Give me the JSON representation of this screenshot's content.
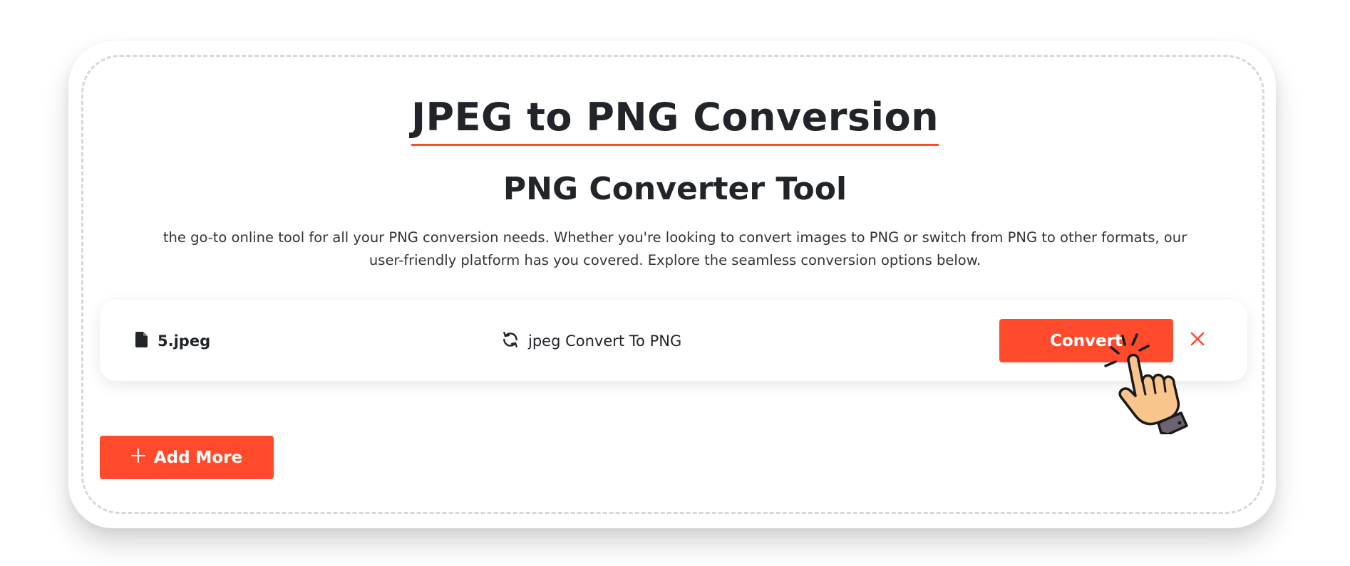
{
  "header": {
    "title": "JPEG to PNG Conversion",
    "subtitle": "PNG Converter Tool",
    "description": "the go-to online tool for all your PNG conversion needs. Whether you're looking to convert images to PNG or switch from PNG to other formats, our user-friendly platform has you covered. Explore the seamless conversion options below."
  },
  "file_row": {
    "file_icon": "file-icon",
    "file_name": "5.jpeg",
    "convert_icon": "sync-icon",
    "conversion_label": "jpeg Convert To PNG",
    "convert_button_label": "Convert",
    "remove_icon": "close-icon"
  },
  "actions": {
    "add_more_icon": "plus-icon",
    "add_more_label": "Add More"
  },
  "decoration": {
    "pointer": "hand-click-icon"
  },
  "colors": {
    "accent": "#ff4b2b",
    "text": "#212529",
    "dashed_border": "#d8d8d8"
  }
}
